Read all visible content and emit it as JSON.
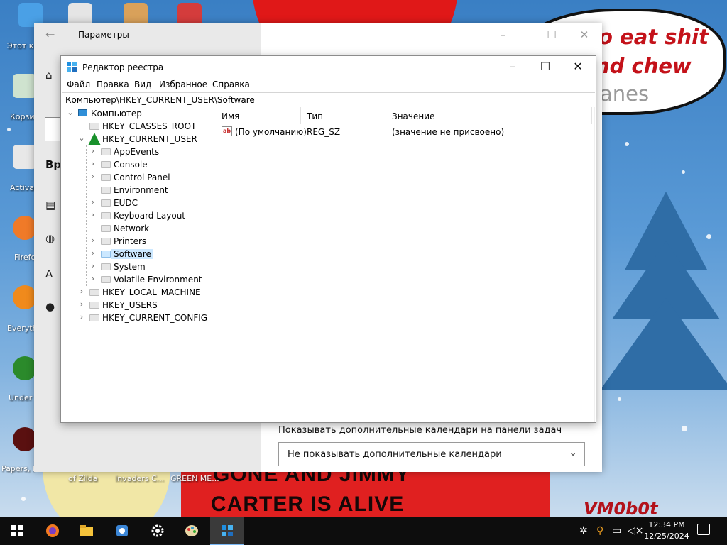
{
  "desktop": {
    "icons": [
      {
        "label": "Этот компьютер",
        "icon": "this-pc-icon"
      },
      {
        "label": "Корзина",
        "icon": "recycle-bin-icon"
      },
      {
        "label": "Activa",
        "icon": "activate-icon"
      },
      {
        "label": "Firefox",
        "icon": "firefox-icon"
      },
      {
        "label": "Everyth",
        "icon": "everything-search-icon"
      },
      {
        "label": "Under",
        "icon": "undertale-icon"
      },
      {
        "label": "Papers, P",
        "icon": "papers-please-icon"
      }
    ],
    "top_icons": [
      "app-icon",
      "game-icon",
      "clown-icon",
      "santa-icon"
    ],
    "bottom_labels": [
      "of Zilda",
      "Invaders C...",
      "GREEN ME..."
    ],
    "wallpaper": {
      "bubble_lines": [
        "o eat shit",
        "nd chew",
        "anes"
      ],
      "caption_lines": [
        "GONE AND JIMMY",
        "CARTER IS ALIVE"
      ],
      "signature": "VM0b0t"
    }
  },
  "settings": {
    "title": "Параметры",
    "side_fragment": "Вре",
    "calendar_label": "Показывать дополнительные календари на панели задач",
    "calendar_value": "Не показывать дополнительные календари"
  },
  "regedit": {
    "title": "Редактор реестра",
    "menu": [
      "Файл",
      "Правка",
      "Вид",
      "Избранное",
      "Справка"
    ],
    "address": "Компьютер\\HKEY_CURRENT_USER\\Software",
    "tree": {
      "root": "Компьютер",
      "hkey_classes_root": "HKEY_CLASSES_ROOT",
      "hkey_current_user": "HKEY_CURRENT_USER",
      "children": [
        "AppEvents",
        "Console",
        "Control Panel",
        "Environment",
        "EUDC",
        "Keyboard Layout",
        "Network",
        "Printers",
        "Software",
        "System",
        "Volatile Environment"
      ],
      "selected": "Software",
      "hkey_local_machine": "HKEY_LOCAL_MACHINE",
      "hkey_users": "HKEY_USERS",
      "hkey_current_config": "HKEY_CURRENT_CONFIG"
    },
    "columns": [
      "Имя",
      "Тип",
      "Значение"
    ],
    "rows": [
      {
        "name": "(По умолчанию)",
        "type": "REG_SZ",
        "value": "(значение не присвоено)"
      }
    ]
  },
  "taskbar": {
    "apps": [
      "windows-start-icon",
      "firefox-icon",
      "file-explorer-icon",
      "app-icon",
      "settings-gear-icon",
      "paint-icon",
      "regedit-icon"
    ],
    "time": "12:34 PM",
    "date": "12/25/2024",
    "colors": {
      "taskbar": "#0d0d0d",
      "accent": "#7ab8f5",
      "selection": "#cce8ff"
    }
  }
}
